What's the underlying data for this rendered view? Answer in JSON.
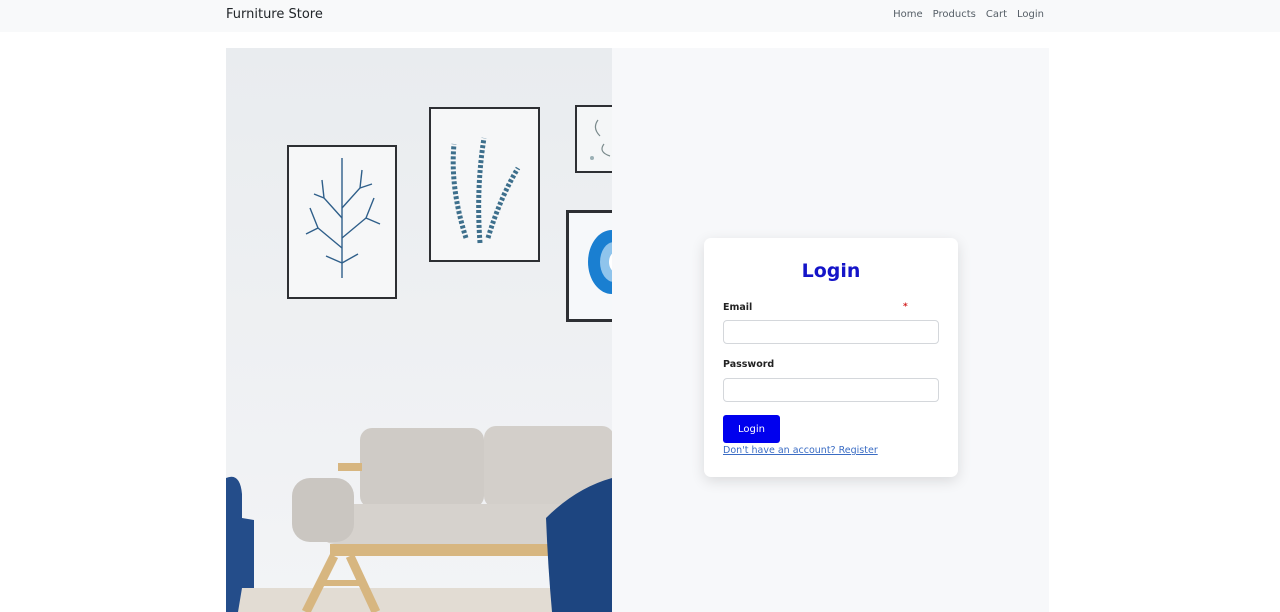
{
  "navbar": {
    "brand": "Furniture Store",
    "links": [
      "Home",
      "Products",
      "Cart",
      "Login"
    ]
  },
  "login": {
    "title": "Login",
    "email_label": "Email",
    "required_mark": "*",
    "password_label": "Password",
    "button_label": "Login",
    "register_text": "Don't have an account? Register"
  },
  "colors": {
    "accent": "#0000ee",
    "title": "#1414c8",
    "link": "#3a6cc4",
    "navbar_bg": "#f8f9fa",
    "panel_bg": "#f7f8fa"
  }
}
